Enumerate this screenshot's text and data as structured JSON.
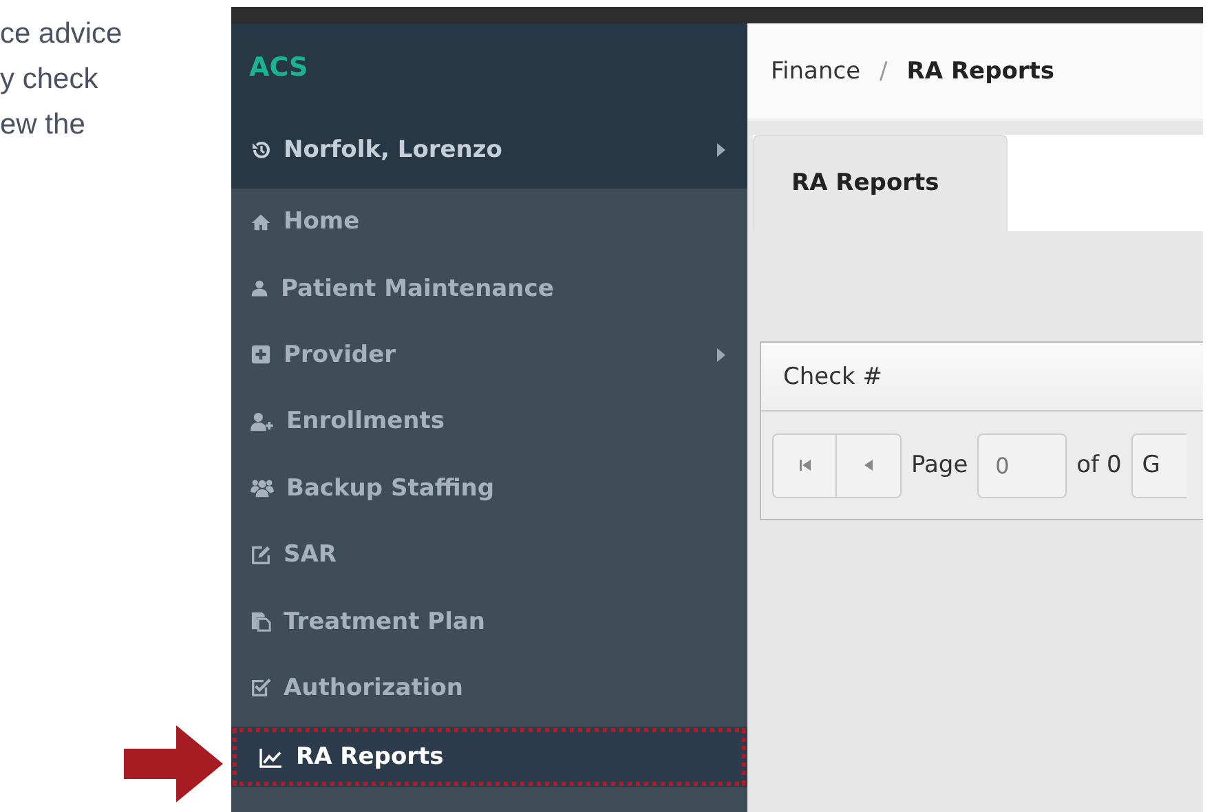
{
  "intro_text": [
    "ce advice",
    "y check",
    "ew the"
  ],
  "sidebar": {
    "brand": "ACS",
    "user": {
      "name": "Norfolk, Lorenzo",
      "has_submenu": true
    },
    "items": [
      {
        "label": "Home",
        "has_submenu": false,
        "selected": false
      },
      {
        "label": "Patient Maintenance",
        "has_submenu": false,
        "selected": false
      },
      {
        "label": "Provider",
        "has_submenu": true,
        "selected": false
      },
      {
        "label": "Enrollments",
        "has_submenu": false,
        "selected": false
      },
      {
        "label": "Backup Staffing",
        "has_submenu": false,
        "selected": false
      },
      {
        "label": "SAR",
        "has_submenu": false,
        "selected": false
      },
      {
        "label": "Treatment Plan",
        "has_submenu": false,
        "selected": false
      },
      {
        "label": "Authorization",
        "has_submenu": false,
        "selected": false
      },
      {
        "label": "RA Reports",
        "has_submenu": false,
        "selected": true
      }
    ]
  },
  "breadcrumb": {
    "separator": "/",
    "items": [
      "Finance",
      "RA Reports"
    ]
  },
  "tabs": [
    {
      "label": "RA Reports",
      "selected": true
    }
  ],
  "grid": {
    "columns": [
      "Check #"
    ],
    "pager": {
      "page_label": "Page",
      "page_value": "0",
      "of_label": "of 0",
      "go_button": "G"
    }
  }
}
